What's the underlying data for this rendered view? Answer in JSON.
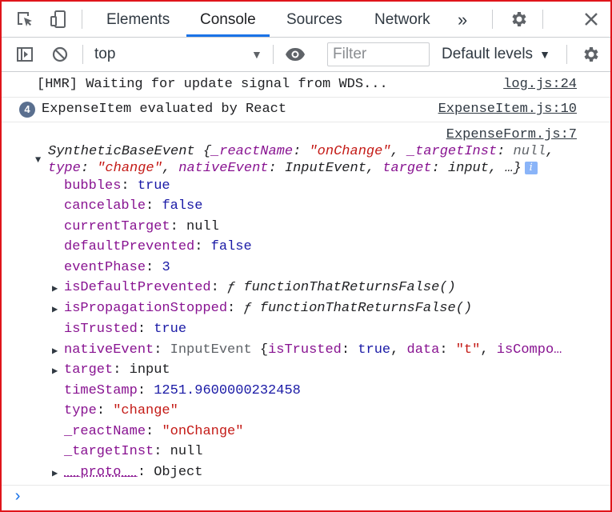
{
  "colors": {
    "accent": "#1a73e8",
    "key": "#881391",
    "string": "#c41a16",
    "number": "#1a1aa6",
    "frame": "#e0151b"
  },
  "tabbar": {
    "icons": [
      "inspect-element-icon",
      "device-toolbar-icon"
    ],
    "tabs": [
      {
        "label": "Elements"
      },
      {
        "label": "Console",
        "active": true
      },
      {
        "label": "Sources"
      },
      {
        "label": "Network"
      }
    ],
    "more_label": "»",
    "right_icons": [
      "gear-icon",
      "close-icon"
    ]
  },
  "toolbar": {
    "context": "top",
    "filter_placeholder": "Filter",
    "levels_label": "Default levels"
  },
  "messages": {
    "hmr": {
      "text": "[HMR] Waiting for update signal from WDS...",
      "source": "log.js:24"
    },
    "expense": {
      "count": "4",
      "text": "ExpenseItem evaluated by React",
      "source": "ExpenseItem.js:10"
    },
    "event": {
      "source": "ExpenseForm.js:7",
      "header": {
        "type": "SyntheticBaseEvent",
        "open": "{",
        "k1": "_reactName",
        "v1": "\"onChange\"",
        "k2": "_targetInst",
        "v2": "null",
        "k3": "type",
        "v3": "\"change\"",
        "k4": "nativeEvent",
        "v4": "InputEvent",
        "k5": "target",
        "v5": "input",
        "ellipsis": "…}"
      },
      "props": [
        {
          "key": "bubbles",
          "value": "true",
          "kind": "bool"
        },
        {
          "key": "cancelable",
          "value": "false",
          "kind": "bool"
        },
        {
          "key": "currentTarget",
          "value": "null",
          "kind": "plain"
        },
        {
          "key": "defaultPrevented",
          "value": "false",
          "kind": "bool"
        },
        {
          "key": "eventPhase",
          "value": "3",
          "kind": "num"
        },
        {
          "key": "isDefaultPrevented",
          "f": "ƒ",
          "value": "functionThatReturnsFalse()",
          "kind": "func",
          "expandable": true
        },
        {
          "key": "isPropagationStopped",
          "f": "ƒ",
          "value": "functionThatReturnsFalse()",
          "kind": "func",
          "expandable": true
        },
        {
          "key": "isTrusted",
          "value": "true",
          "kind": "bool"
        },
        {
          "key": "nativeEvent",
          "type": "InputEvent",
          "open": "{",
          "k1": "isTrusted",
          "v1": "true",
          "k2": "data",
          "v2": "\"t\"",
          "k3": "isCompo…",
          "kind": "native",
          "expandable": true
        },
        {
          "key": "target",
          "value": "input",
          "kind": "plain",
          "expandable": true
        },
        {
          "key": "timeStamp",
          "value": "1251.9600000232458",
          "kind": "num"
        },
        {
          "key": "type",
          "value": "\"change\"",
          "kind": "str"
        },
        {
          "key": "_reactName",
          "value": "\"onChange\"",
          "kind": "str"
        },
        {
          "key": "_targetInst",
          "value": "null",
          "kind": "plain"
        },
        {
          "key": "__proto__",
          "value": "Object",
          "kind": "plain",
          "expandable": true
        }
      ]
    }
  },
  "prompt": "›"
}
